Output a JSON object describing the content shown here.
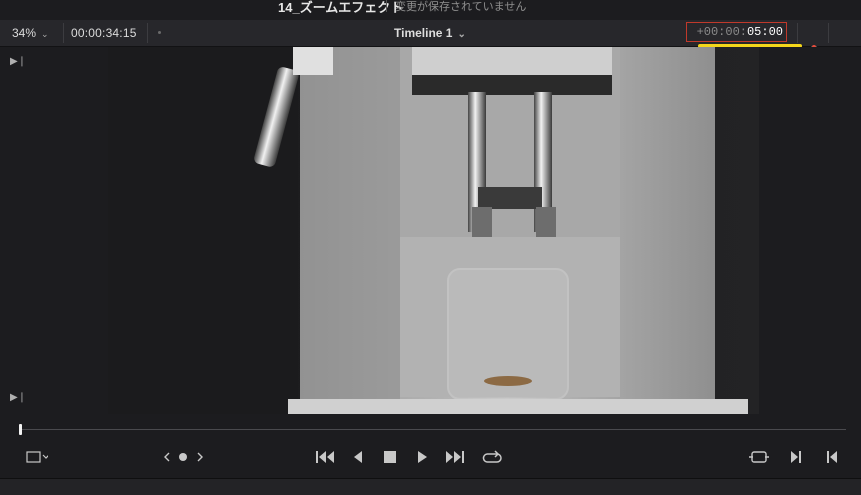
{
  "header": {
    "project_title": "14_ズームエフェクト",
    "save_status": "変更が保存されていません"
  },
  "toolbar": {
    "zoom_level": "34%",
    "source_timecode": "00:00:34:15",
    "timeline_name": "Timeline 1",
    "duration_prefix": "+00:00:",
    "duration_value": "05:00"
  },
  "colors": {
    "accent_highlight": "#f4d61a",
    "duration_border": "#c0392b"
  },
  "transport": {
    "icons": [
      "crop-icon",
      "nav-left-icon",
      "nav-dot-icon",
      "nav-right-icon",
      "first-frame-icon",
      "step-back-icon",
      "stop-icon",
      "play-icon",
      "last-frame-icon",
      "loop-icon",
      "match-frame-icon",
      "in-point-icon",
      "out-point-icon"
    ]
  }
}
